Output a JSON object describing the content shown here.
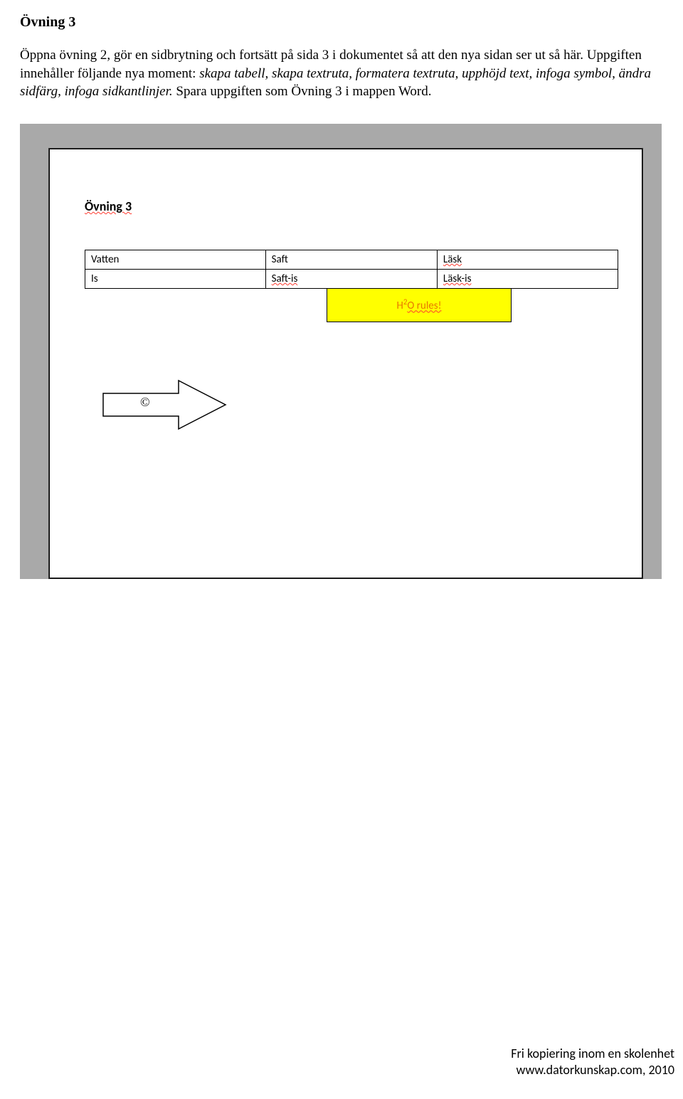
{
  "heading": "Övning 3",
  "instructions": {
    "part1": "Öppna övning 2, gör en sidbrytning och fortsätt på sida 3 i dokumentet så att den nya sidan ser ut så här. Uppgiften innehåller följande nya moment: ",
    "italic": "skapa tabell, skapa textruta, formatera textruta, upphöjd text, infoga symbol, ändra sidfärg, infoga sidkantlinjer.",
    "part2": " Spara uppgiften som Övning 3 i mappen Word."
  },
  "screenshot": {
    "doc_title": "Övning 3",
    "table": {
      "rows": [
        [
          "Vatten",
          "Saft",
          "Läsk"
        ],
        [
          "Is",
          "Saft-is",
          "Läsk-is"
        ]
      ]
    },
    "textbox": {
      "prefix": "H",
      "sup": "2",
      "suffix": "O rules!"
    },
    "arrow_symbol": "©"
  },
  "footer": {
    "line1": "Fri kopiering inom en skolenhet",
    "line2": "www.datorkunskap.com, 2010"
  }
}
